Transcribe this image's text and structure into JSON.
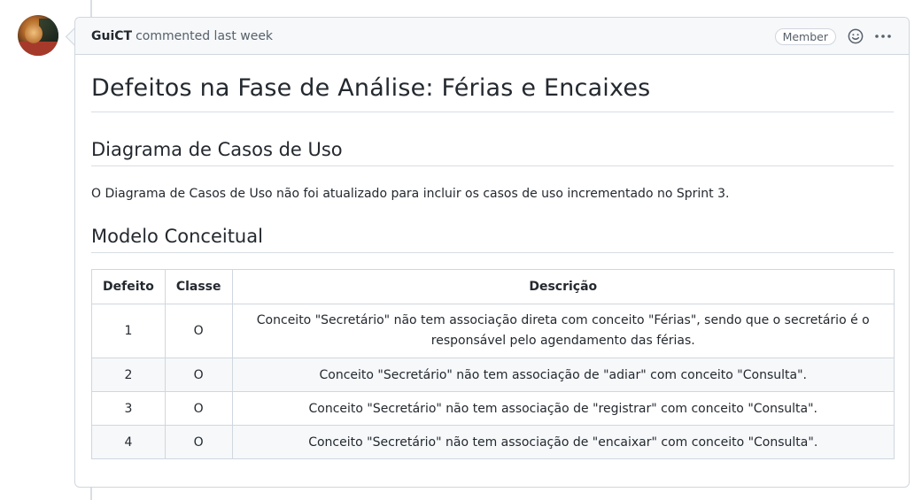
{
  "comment": {
    "author": "GuiCT",
    "action_text": "commented last week",
    "role_badge": "Member",
    "icons": [
      "smiley-icon",
      "kebab-icon"
    ]
  },
  "body": {
    "title": "Defeitos na Fase de Análise: Férias e Encaixes",
    "section1_heading": "Diagrama de Casos de Uso",
    "section1_text": "O Diagrama de Casos de Uso não foi atualizado para incluir os casos de uso incrementado no Sprint 3.",
    "section2_heading": "Modelo Conceitual",
    "table": {
      "headers": [
        "Defeito",
        "Classe",
        "Descrição"
      ],
      "rows": [
        [
          "1",
          "O",
          "Conceito \"Secretário\" não tem associação direta com conceito \"Férias\", sendo que o secretário é o responsável pelo agendamento das férias."
        ],
        [
          "2",
          "O",
          "Conceito \"Secretário\" não tem associação de \"adiar\" com conceito \"Consulta\"."
        ],
        [
          "3",
          "O",
          "Conceito \"Secretário\" não tem associação de \"registrar\" com conceito \"Consulta\"."
        ],
        [
          "4",
          "O",
          "Conceito \"Secretário\" não tem associação de \"encaixar\" com conceito \"Consulta\"."
        ]
      ]
    }
  },
  "colors": {
    "border": "#d0d7de",
    "header_bg": "#f6f8fa",
    "text": "#24292f",
    "muted": "#57606a"
  }
}
